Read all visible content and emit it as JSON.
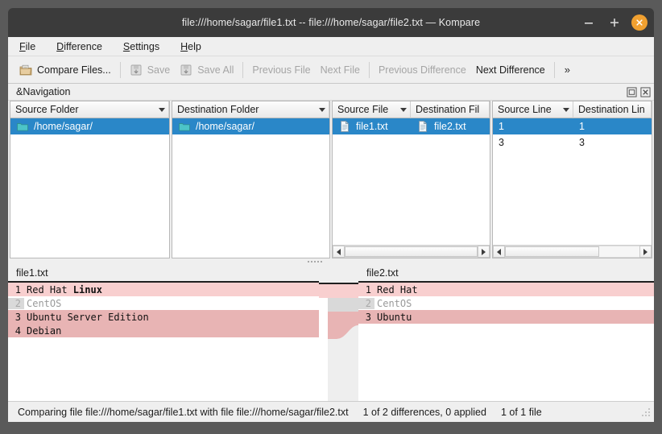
{
  "window": {
    "title": "file:///home/sagar/file1.txt -- file:///home/sagar/file2.txt — Kompare",
    "minimize_label": "–",
    "maximize_label": "+",
    "close_label": "✕"
  },
  "menubar": {
    "items": [
      {
        "accel": "F",
        "rest": "ile"
      },
      {
        "accel": "D",
        "rest": "ifference"
      },
      {
        "accel": "S",
        "rest": "ettings"
      },
      {
        "accel": "H",
        "rest": "elp"
      }
    ]
  },
  "toolbar": {
    "compare_files": "Compare Files...",
    "save": "Save",
    "save_all": "Save All",
    "previous_file": "Previous File",
    "next_file": "Next File",
    "previous_difference": "Previous Difference",
    "next_difference": "Next Difference",
    "overflow": "»"
  },
  "navigation": {
    "title": "&Navigation",
    "columns": [
      {
        "label": "Source Folder",
        "sortable": true
      },
      {
        "label": "Destination Folder",
        "sortable": true
      },
      {
        "label": "Source File",
        "sortable": true
      },
      {
        "label": "Destination Fil",
        "sortable": false
      },
      {
        "label": "Source Line",
        "sortable": true
      },
      {
        "label": "Destination Lin",
        "sortable": false
      }
    ],
    "source_folders": [
      {
        "name": "/home/sagar/",
        "selected": true
      }
    ],
    "destination_folders": [
      {
        "name": "/home/sagar/",
        "selected": true
      }
    ],
    "files": [
      {
        "source": "file1.txt",
        "destination": "file2.txt",
        "selected": true
      }
    ],
    "lines": [
      {
        "source": "1",
        "destination": "1",
        "selected": true
      },
      {
        "source": "3",
        "destination": "3",
        "selected": false
      }
    ]
  },
  "diff": {
    "left": {
      "header": "file1.txt",
      "lines": [
        {
          "num": "1",
          "pre": "Red Hat ",
          "bold": "Linux",
          "post": "",
          "state": "change"
        },
        {
          "num": "2",
          "pre": "CentOS",
          "bold": "",
          "post": "",
          "state": "unchanged"
        },
        {
          "num": "3",
          "pre": "Ubuntu Server Edition",
          "bold": "",
          "post": "",
          "state": "change2"
        },
        {
          "num": "4",
          "pre": "Debian",
          "bold": "",
          "post": "",
          "state": "change2"
        }
      ]
    },
    "right": {
      "header": "file2.txt",
      "lines": [
        {
          "num": "1",
          "pre": "Red Hat",
          "bold": "",
          "post": "",
          "state": "change"
        },
        {
          "num": "2",
          "pre": "CentOS",
          "bold": "",
          "post": "",
          "state": "unchanged"
        },
        {
          "num": "3",
          "pre": "Ubuntu",
          "bold": "",
          "post": "",
          "state": "change2"
        }
      ]
    }
  },
  "statusbar": {
    "comparing": "Comparing file file:///home/sagar/file1.txt with file file:///home/sagar/file2.txt",
    "differences": "1 of 2 differences, 0 applied",
    "files": "1 of 1 file"
  },
  "colors": {
    "selection_blue": "#2a87c8",
    "change_pink": "#f8cfcf",
    "change_pink_dark": "#e8b4b4",
    "close_orange": "#f0a030",
    "titlebar": "#3b3b3b"
  }
}
